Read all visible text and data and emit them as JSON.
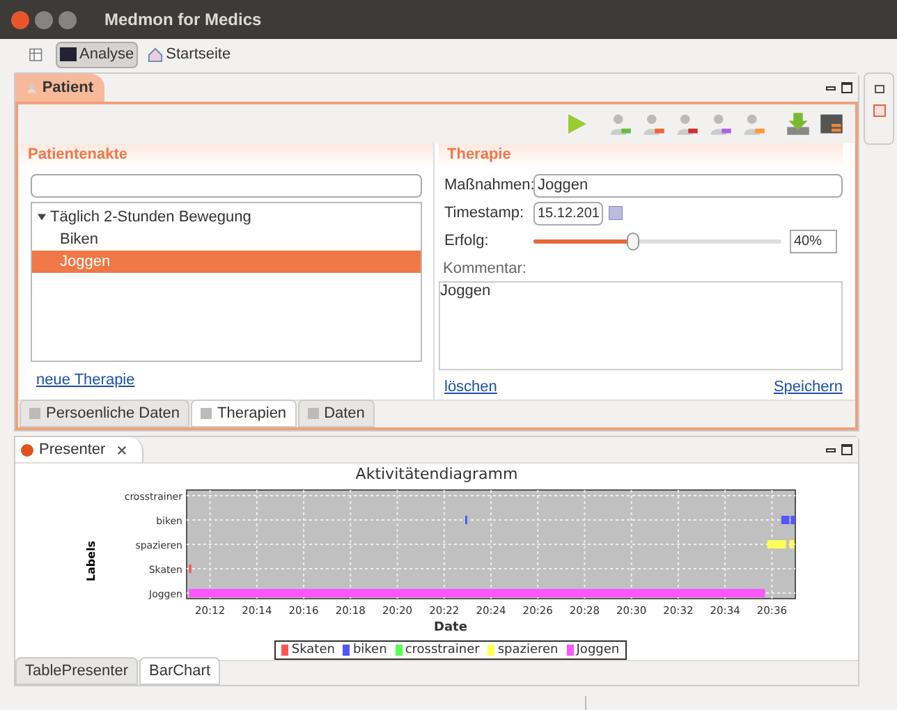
{
  "window": {
    "title": "Medmon for Medics"
  },
  "toolbar": {
    "items": [
      {
        "label": "Analyse",
        "selected": true
      },
      {
        "label": "Startseite",
        "selected": false
      }
    ]
  },
  "patient_view": {
    "tab": "Patient",
    "patientenakte": {
      "title": "Patientenakte",
      "tree": [
        {
          "label": "Täglich 2-Stunden Bewegung",
          "expanded": true,
          "selected": false,
          "children": [
            {
              "label": "Biken",
              "selected": false
            },
            {
              "label": "Joggen",
              "selected": true
            }
          ]
        }
      ],
      "link": "neue Therapie"
    },
    "therapie": {
      "title": "Therapie",
      "massnahmen_label": "Maßnahmen:",
      "massnahmen": "Joggen",
      "timestamp_label": "Timestamp:",
      "timestamp": "15.12.201",
      "erfolg_label": "Erfolg:",
      "erfolg": {
        "level": 0.4
      },
      "erfolg_reading": "40%",
      "kommentar_label": "Kommentar:",
      "kommentar": "Joggen",
      "delete_link": "löschen",
      "save_link": "Speichern"
    },
    "bottom_tabs": [
      {
        "label": "Persoenliche Daten",
        "selected": false
      },
      {
        "label": "Therapien",
        "selected": true
      },
      {
        "label": "Daten",
        "selected": false
      }
    ]
  },
  "presenter_view": {
    "tab": "Presenter",
    "activity_chart": {
      "title": "Aktivitätendiagramm",
      "xlabel": "Date",
      "ylabel": "Labels",
      "row_labels": [
        "crosstrainer",
        "biken",
        "spazieren",
        "Skaten",
        "Joggen"
      ],
      "tick_labels": [
        "20:12",
        "20:14",
        "20:16",
        "20:18",
        "20:20",
        "20:22",
        "20:24",
        "20:26",
        "20:28",
        "20:30",
        "20:32",
        "20:34",
        "20:36"
      ],
      "legend": [
        {
          "name": "Skaten",
          "color": "#ff5555"
        },
        {
          "name": "biken",
          "color": "#5555ff"
        },
        {
          "name": "crosstrainer",
          "color": "#55ff55"
        },
        {
          "name": "spazieren",
          "color": "#ffff55"
        },
        {
          "name": "Joggen",
          "color": "#ff55ff"
        }
      ]
    },
    "bottom_tabs": [
      {
        "label": "TablePresenter",
        "selected": false
      },
      {
        "label": "BarChart",
        "selected": true
      }
    ]
  }
}
